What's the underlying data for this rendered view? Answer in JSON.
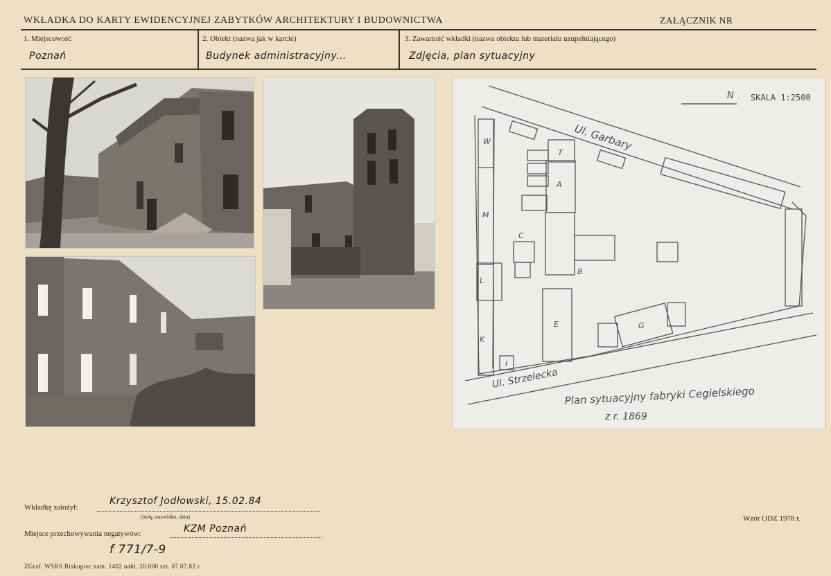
{
  "header": {
    "title": "WKŁADKA DO KARTY EWIDENCYJNEJ ZABYTKÓW ARCHITEKTURY I BUDOWNICTWA",
    "attachment": "ZAŁĄCZNIK NR"
  },
  "fields": [
    {
      "label": "1. Miejscowość",
      "value": "Poznań"
    },
    {
      "label": "2. Obiekt (nazwa jak w karcie)",
      "value": "Budynek administracyjny..."
    },
    {
      "label": "3. Zawartość wkładki (nazwa obiektu lub materiału uzupełniającego)",
      "value": "Zdjęcia, plan sytuacyjny"
    }
  ],
  "plan": {
    "north": "N",
    "scale": "SKALA 1:2500",
    "street_top": "Ul. Garbary",
    "street_bottom": "Ul. Strzelecka",
    "caption_line1": "Plan sytuacyjny fabryki Cegielskiego",
    "caption_line2": "z r. 1869",
    "letters": [
      "W",
      "T",
      "A",
      "M",
      "C",
      "B",
      "L",
      "E",
      "G",
      "K",
      "I"
    ]
  },
  "bottom": {
    "founded_label": "Wkładkę założył:",
    "founded_value": "Krzysztof Jodłowski, 15.02.84",
    "founded_hint": "(imię, nazwisko, data)",
    "storage_label": "Miejsce przechowywania negatywów:",
    "storage_value": "KZM Poznań",
    "negative_number": "f 771/7-9",
    "form_ref": "Wzór ODZ 1978 r.",
    "printer": "ZGraf. WSRS Biskupiec zam. 1402 nakł. 20.000 szt. 07.07.82 r."
  }
}
